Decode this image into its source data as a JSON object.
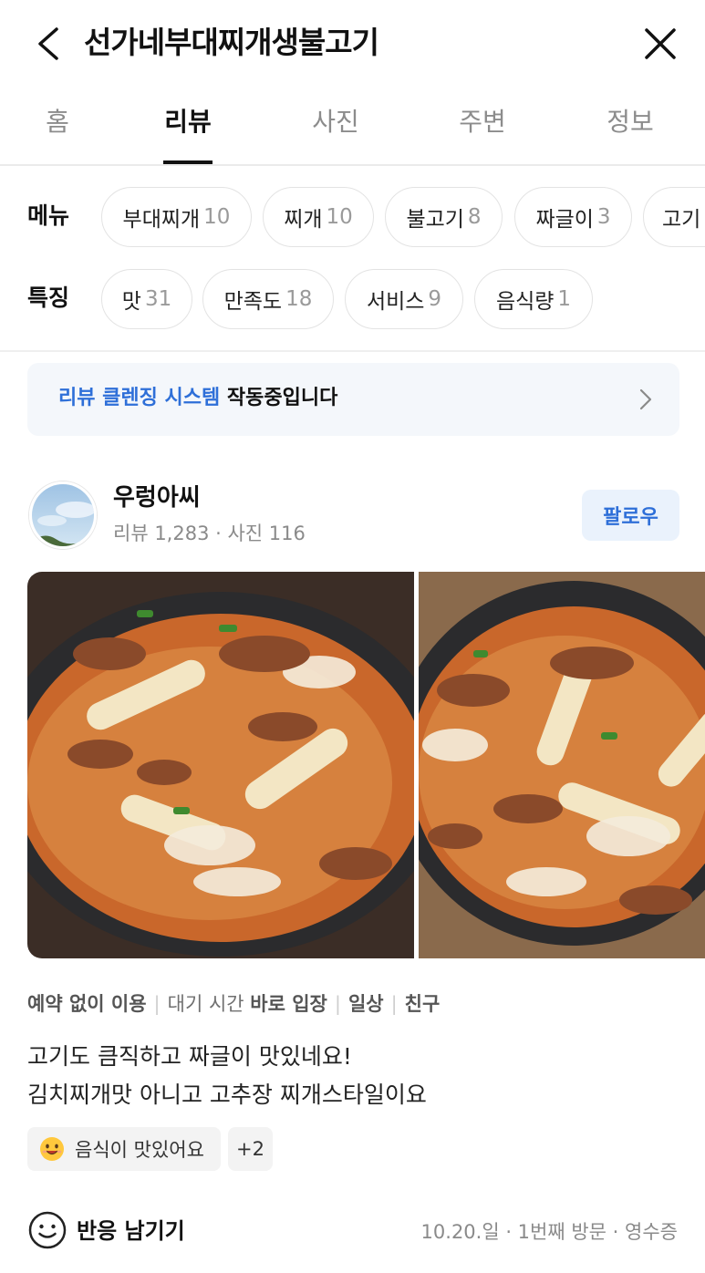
{
  "header": {
    "title": "선가네부대찌개생불고기"
  },
  "tabs": [
    {
      "label": "홈",
      "active": false
    },
    {
      "label": "리뷰",
      "active": true
    },
    {
      "label": "사진",
      "active": false
    },
    {
      "label": "주변",
      "active": false
    },
    {
      "label": "정보",
      "active": false
    }
  ],
  "filters": {
    "menu": {
      "label": "메뉴",
      "chips": [
        {
          "name": "부대찌개",
          "count": "10"
        },
        {
          "name": "찌개",
          "count": "10"
        },
        {
          "name": "불고기",
          "count": "8"
        },
        {
          "name": "짜글이",
          "count": "3"
        },
        {
          "name": "고기",
          "count": ""
        }
      ]
    },
    "feature": {
      "label": "특징",
      "chips": [
        {
          "name": "맛",
          "count": "31"
        },
        {
          "name": "만족도",
          "count": "18"
        },
        {
          "name": "서비스",
          "count": "9"
        },
        {
          "name": "음식량",
          "count": "1"
        }
      ]
    }
  },
  "banner": {
    "highlight": "리뷰 클렌징 시스템",
    "rest": " 작동중입니다"
  },
  "review": {
    "user_name": "우렁아씨",
    "user_stats": "리뷰 1,283 · 사진 116",
    "follow_label": "팔로우",
    "tags": [
      {
        "prefix": "",
        "value": "예약 없이 이용"
      },
      {
        "prefix": "대기 시간 ",
        "value": "바로 입장"
      },
      {
        "prefix": "",
        "value": "일상"
      },
      {
        "prefix": "",
        "value": "친구"
      }
    ],
    "text_line1": "고기도 큼직하고 짜글이 맛있네요!",
    "text_line2": "김치찌개맛 아니고 고추장 찌개스타일이요",
    "reaction_label": "음식이 맛있어요",
    "reaction_more": "+2",
    "react_button_label": "반응 남기기",
    "visit_info": "10.20.일 · 1번째 방문 · 영수증"
  },
  "colors": {
    "accent_blue": "#2e6fd8",
    "follow_bg": "#eaf2fc",
    "banner_bg": "#f4f7fb"
  },
  "icons": [
    "back-arrow-icon",
    "close-icon",
    "chevron-right-icon",
    "smile-emoji-icon",
    "smile-outline-icon"
  ]
}
